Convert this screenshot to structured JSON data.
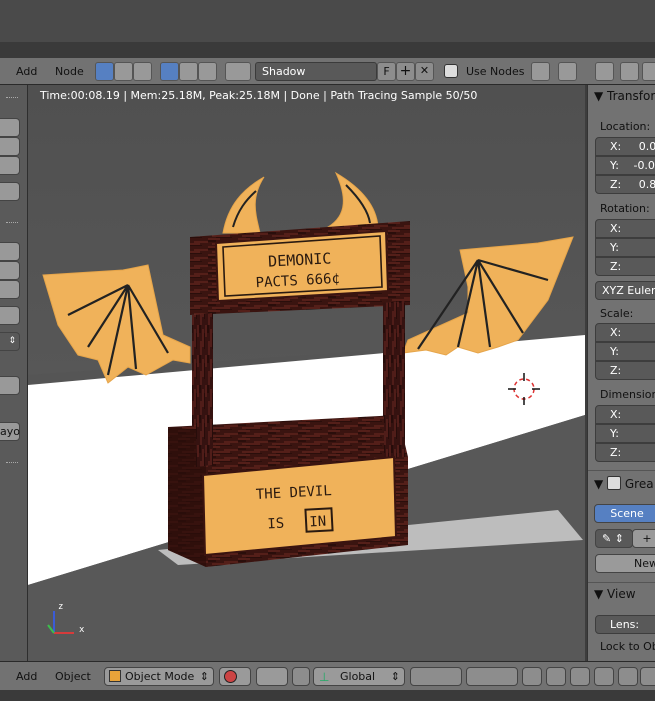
{
  "header": {
    "menu_add": "Add",
    "menu_node": "Node",
    "material_name": "Shadow",
    "fake_user_label": "F",
    "use_nodes_label": "Use Nodes",
    "icons": [
      "render-icon",
      "world-icon",
      "texture-icon",
      "object-icon",
      "sphere-icon",
      "brush-icon",
      "material-icon",
      "pin-icon",
      "parent-icon",
      "screen-icon",
      "link-icon",
      "layers-icon"
    ]
  },
  "viewport": {
    "info": "Time:00:08.19 | Mem:25.18M, Peak:25.18M | Done | Path Tracing Sample 50/50",
    "scene": {
      "sign_top_line1": "DEMONIC",
      "sign_top_line2": "PACTS 666¢",
      "sign_bottom_line1": "THE DEVIL",
      "sign_bottom_is": "IS",
      "sign_bottom_in": "IN"
    },
    "axis_z": "z",
    "axis_x": "x",
    "left_tool_partial": "ayo"
  },
  "properties": {
    "transform_header": "Transfor",
    "location_label": "Location:",
    "loc_x_label": "X:",
    "loc_x_value": "0.0",
    "loc_y_label": "Y:",
    "loc_y_value": "-0.0",
    "loc_z_label": "Z:",
    "loc_z_value": "0.8",
    "rotation_label": "Rotation:",
    "rot_x_label": "X:",
    "rot_y_label": "Y:",
    "rot_z_label": "Z:",
    "rotation_mode": "XYZ Euler",
    "scale_label": "Scale:",
    "scale_x_label": "X:",
    "scale_y_label": "Y:",
    "scale_z_label": "Z:",
    "dimensions_label": "Dimensions",
    "dim_x_label": "X:",
    "dim_y_label": "Y:",
    "dim_z_label": "Z:",
    "grease_header": "Grea",
    "scene_button": "Scene",
    "new_button": "New",
    "view_header": "View",
    "lens_label": "Lens:",
    "lock_label": "Lock to Obj"
  },
  "footer": {
    "menu_add": "Add",
    "menu_object": "Object",
    "mode": "Object Mode",
    "orientation": "Global"
  },
  "colors": {
    "panel": "#727272",
    "field": "#595959",
    "accent": "#5680c2",
    "sign": "#f0b25a",
    "wood": "#3a1410"
  }
}
